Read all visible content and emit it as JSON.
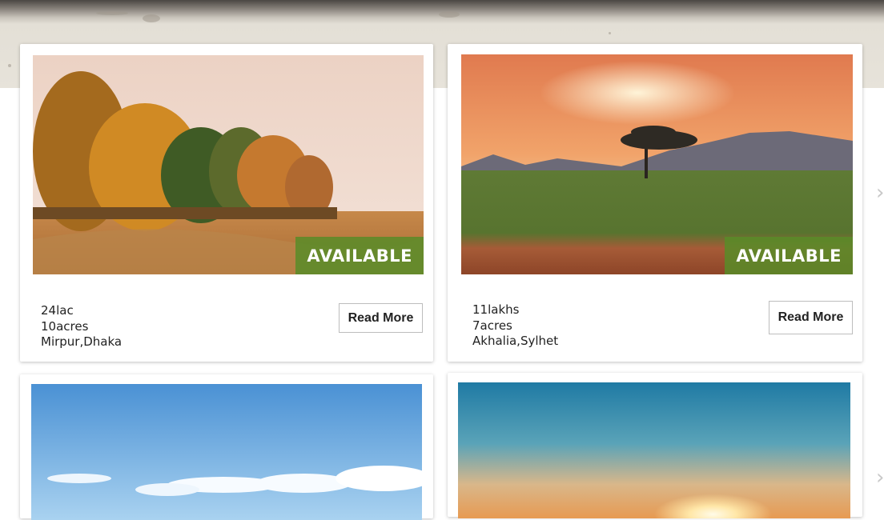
{
  "listings": [
    {
      "price": "24lac",
      "area": "10acres",
      "location": "Mirpur,Dhaka",
      "status": "AVAILABLE",
      "action_label": "Read More",
      "image": "autumn-trees-field"
    },
    {
      "price": "11lakhs",
      "area": "7acres",
      "location": "Akhalia,Sylhet",
      "status": "AVAILABLE",
      "action_label": "Read More",
      "image": "savanna-sunset-acacia"
    },
    {
      "image": "blue-sky-clouds"
    },
    {
      "image": "sunrise-horizon"
    }
  ],
  "nav": {
    "prev_icon": "chevron-left-icon",
    "next_icon": "chevron-right-icon"
  },
  "colors": {
    "badge": "#588c28",
    "button_border": "#bdbdbd",
    "text": "#222222"
  }
}
